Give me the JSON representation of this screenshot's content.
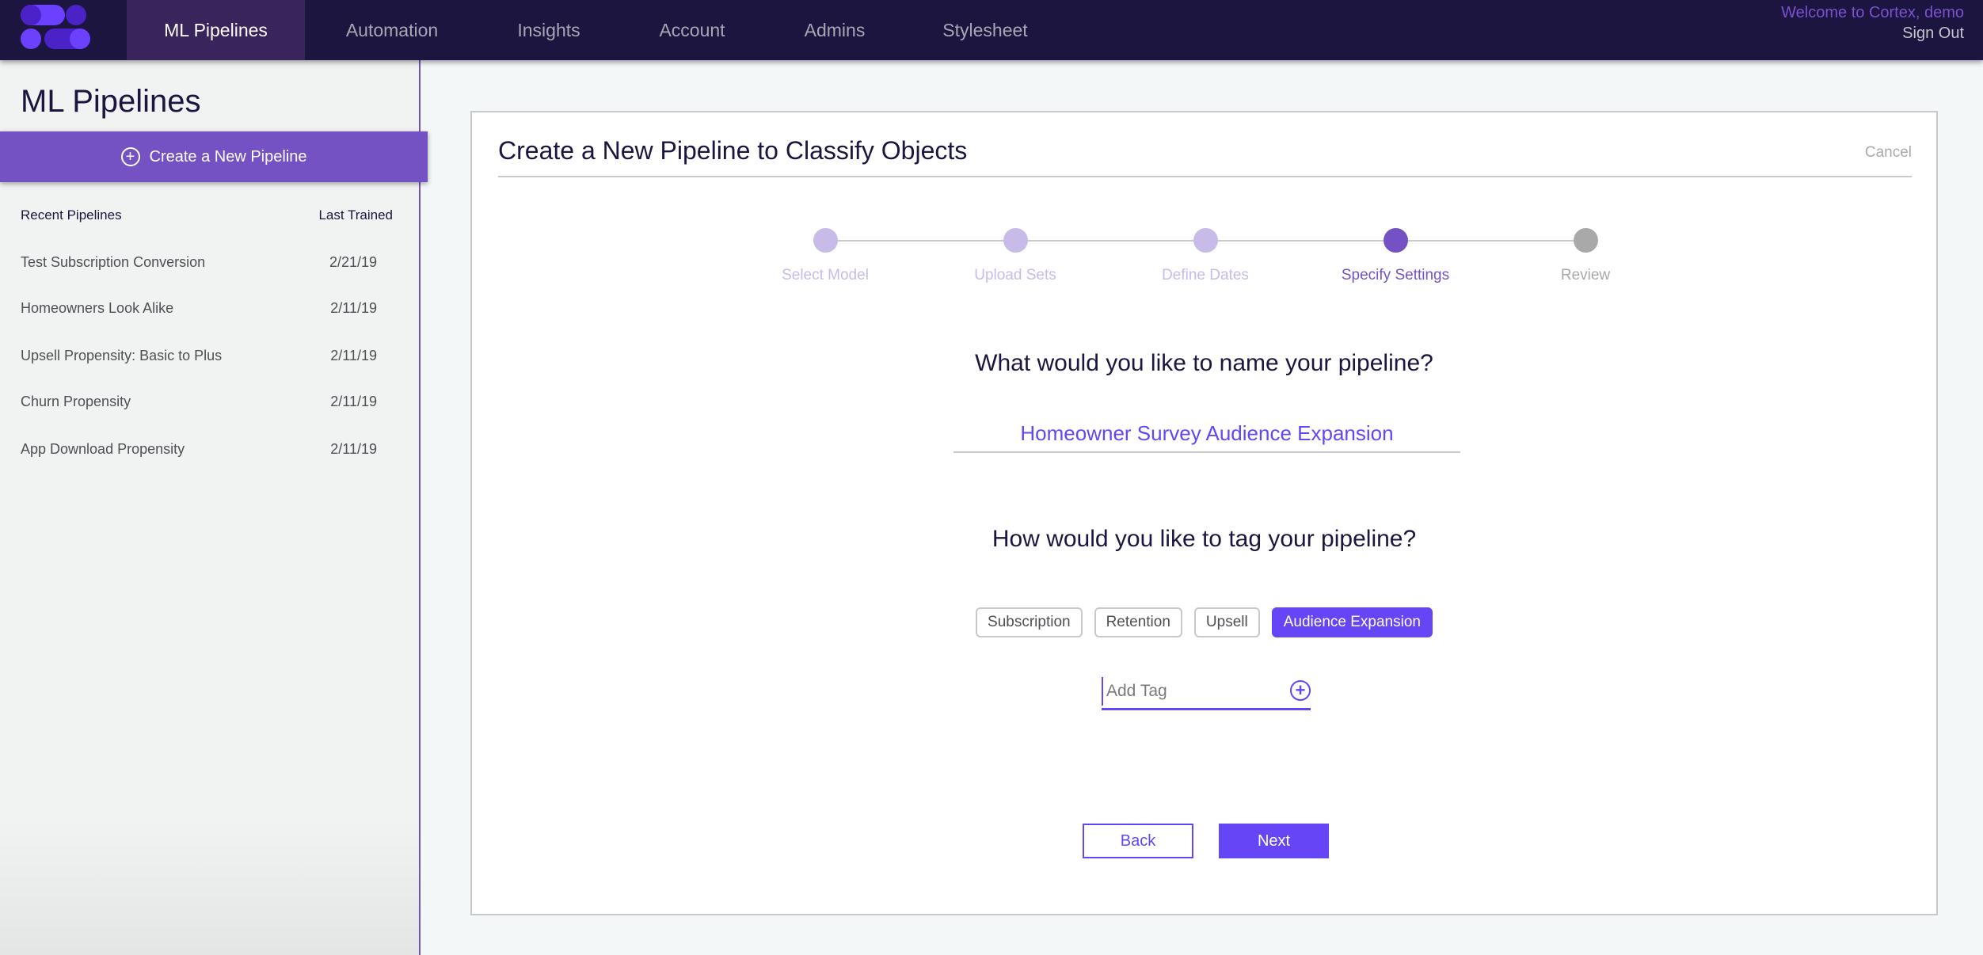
{
  "header": {
    "logo": "cortex-logo",
    "nav": [
      {
        "label": "ML Pipelines",
        "active": true
      },
      {
        "label": "Automation",
        "active": false
      },
      {
        "label": "Insights",
        "active": false
      },
      {
        "label": "Account",
        "active": false
      },
      {
        "label": "Admins",
        "active": false
      },
      {
        "label": "Stylesheet",
        "active": false
      }
    ],
    "welcome": "Welcome to Cortex, demo",
    "sign_out": "Sign Out"
  },
  "sidebar": {
    "title": "ML Pipelines",
    "create_button": {
      "icon": "plus-circle-icon",
      "label": "Create a New Pipeline"
    },
    "recent_header": "Recent Pipelines",
    "trained_header": "Last Trained",
    "pipelines": [
      {
        "name": "Test Subscription Conversion",
        "date": "2/21/19"
      },
      {
        "name": "Homeowners Look Alike",
        "date": "2/11/19"
      },
      {
        "name": "Upsell Propensity: Basic to Plus",
        "date": "2/11/19"
      },
      {
        "name": "Churn Propensity",
        "date": "2/11/19"
      },
      {
        "name": "App Download Propensity",
        "date": "2/11/19"
      }
    ]
  },
  "card": {
    "title": "Create a New Pipeline to Classify Objects",
    "cancel": "Cancel",
    "steps": [
      {
        "label": "Select Model",
        "state": "complete"
      },
      {
        "label": "Upload Sets",
        "state": "complete"
      },
      {
        "label": "Define Dates",
        "state": "complete"
      },
      {
        "label": "Specify Settings",
        "state": "current"
      },
      {
        "label": "Review",
        "state": "future"
      }
    ],
    "name_question": "What would you like to name your pipeline?",
    "name_value": "Homeowner Survey Audience Expansion",
    "tag_question": "How would you like to tag your pipeline?",
    "tags": [
      {
        "label": "Subscription",
        "selected": false
      },
      {
        "label": "Retention",
        "selected": false
      },
      {
        "label": "Upsell",
        "selected": false
      },
      {
        "label": "Audience Expansion",
        "selected": true
      }
    ],
    "add_tag_placeholder": "Add Tag",
    "back": "Back",
    "next": "Next"
  },
  "colors": {
    "header_bg": "#1c1540",
    "active_tab_bg": "#39245c",
    "accent": "#7452c4",
    "primary": "#6545f5",
    "step_complete": "#c8bbea",
    "step_future": "#a9a9a9"
  }
}
